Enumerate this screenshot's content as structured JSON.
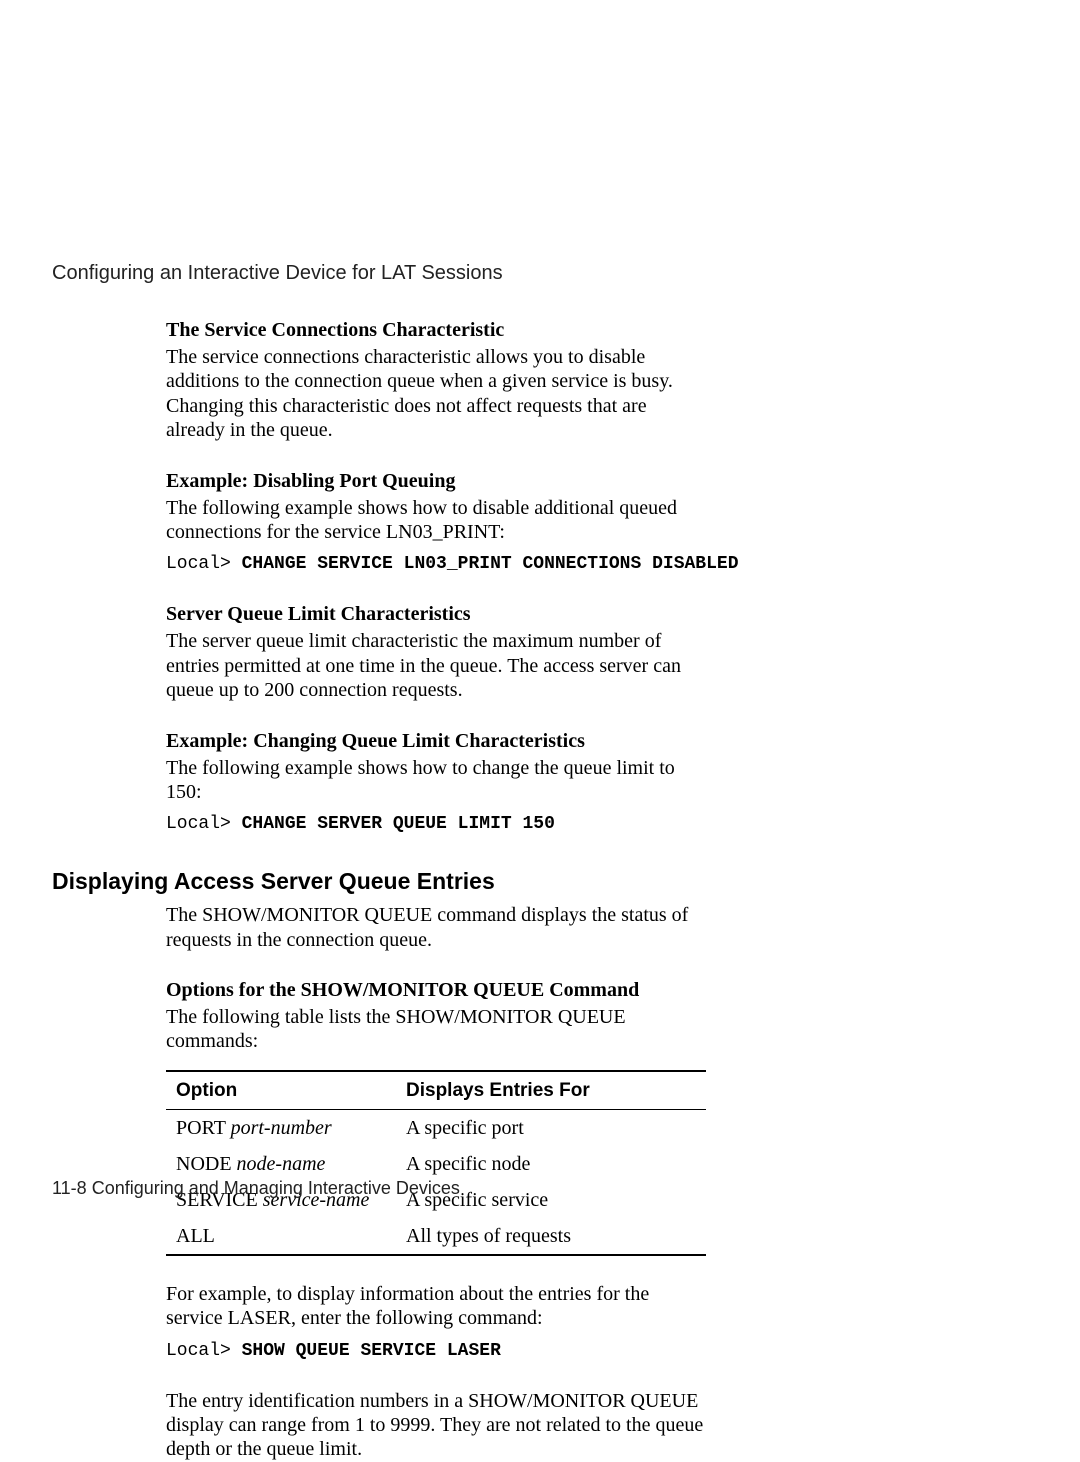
{
  "running_head": "Configuring an Interactive Device for LAT Sessions",
  "sec1": {
    "title": "The Service Connections Characteristic",
    "body": "The service connections characteristic allows you to disable additions to the connection queue when a given service is busy. Changing this characteristic does not affect requests that are already in the queue."
  },
  "sec2": {
    "title": "Example: Disabling Port Queuing",
    "body": "The following example shows how to disable additional queued connections for the service LN03_PRINT:",
    "prompt": "Local> ",
    "cmd": "CHANGE SERVICE LN03_PRINT CONNECTIONS DISABLED"
  },
  "sec3": {
    "title": "Server Queue Limit Characteristics",
    "body": "The server queue limit characteristic the maximum number of entries permitted at one time in the queue. The access server can queue up to 200 connection requests."
  },
  "sec4": {
    "title": "Example: Changing Queue Limit Characteristics",
    "body": "The following example shows how to change the queue limit to 150:",
    "prompt": "Local> ",
    "cmd": "CHANGE SERVER QUEUE LIMIT 150"
  },
  "h2": "Displaying Access Server Queue Entries",
  "sec5": {
    "intro": "The SHOW/MONITOR QUEUE command displays the status of requests in the connection queue.",
    "opts_title": "Options for the SHOW/MONITOR QUEUE Command",
    "table_intro": "The following table lists the SHOW/MONITOR QUEUE commands:",
    "th1": "Option",
    "th2": "Displays Entries For",
    "rows": [
      {
        "opt_kw": "PORT ",
        "opt_arg": "port-number",
        "desc": "A specific port"
      },
      {
        "opt_kw": "NODE ",
        "opt_arg": "node-name",
        "desc": "A specific node"
      },
      {
        "opt_kw": "SERVICE ",
        "opt_arg": "service-name",
        "desc": "A specific service"
      },
      {
        "opt_kw": "ALL",
        "opt_arg": "",
        "desc": "All types of requests"
      }
    ],
    "example_lead": "For example, to display information about the entries for the service LASER, enter the following command:",
    "prompt": "Local> ",
    "cmd": "SHOW QUEUE SERVICE LASER",
    "tail": "The entry identification numbers in a SHOW/MONITOR QUEUE display can range from 1 to 9999. They are not related to the queue depth or the queue limit."
  },
  "footer": "11-8  Configuring and Managing Interactive Devices"
}
